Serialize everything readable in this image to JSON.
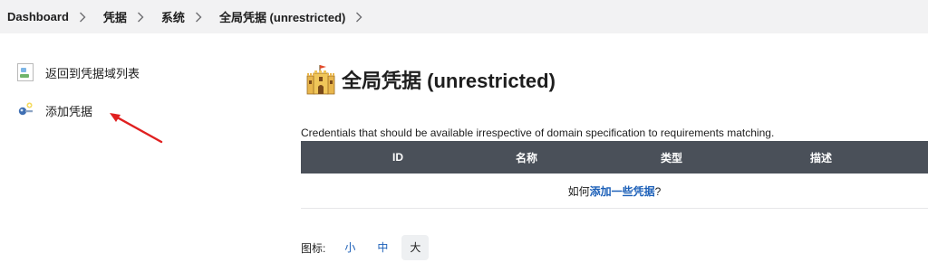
{
  "breadcrumb": {
    "items": [
      "Dashboard",
      "凭据",
      "系统",
      "全局凭据 (unrestricted)"
    ]
  },
  "sidebar": {
    "back_label": "返回到凭据域列表",
    "add_label": "添加凭据"
  },
  "main": {
    "title": "全局凭据 (unrestricted)",
    "description": "Credentials that should be available irrespective of domain specification to requirements matching.",
    "table": {
      "headers": [
        "ID",
        "名称",
        "类型",
        "描述"
      ],
      "empty_prefix": "如何",
      "empty_link": "添加一些凭据",
      "empty_suffix": "?"
    },
    "icon_size": {
      "label": "图标:",
      "options": [
        "小",
        "中",
        "大"
      ],
      "selected": "大"
    }
  },
  "colors": {
    "table_header_bg": "#4a5059",
    "link": "#1b5fb8",
    "breadcrumb_bg": "#f2f2f3",
    "annotation_arrow": "#e02020"
  }
}
